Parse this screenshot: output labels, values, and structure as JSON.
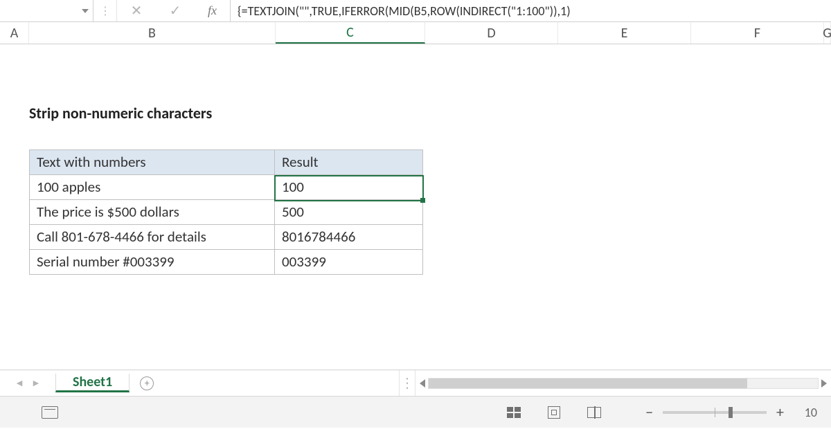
{
  "formula_bar": {
    "cancel_glyph": "✕",
    "accept_glyph": "✓",
    "fx_label": "fx",
    "formula": "{=TEXTJOIN(\"\",TRUE,IFERROR(MID(B5,ROW(INDIRECT(\"1:100\")),1)"
  },
  "columns": {
    "A": "A",
    "B": "B",
    "C": "C",
    "D": "D",
    "E": "E",
    "F": "F",
    "G": "G"
  },
  "heading": "Strip non-numeric characters",
  "table": {
    "header": {
      "b": "Text with numbers",
      "c": "Result"
    },
    "rows": [
      {
        "b": "100 apples",
        "c": "100"
      },
      {
        "b": "The price is $500 dollars",
        "c": "500"
      },
      {
        "b": "Call 801-678-4466 for details",
        "c": "8016784466"
      },
      {
        "b": "Serial number #003399",
        "c": "003399"
      }
    ]
  },
  "tabs": {
    "sheet1": "Sheet1"
  },
  "status": {
    "zoom": "10"
  }
}
